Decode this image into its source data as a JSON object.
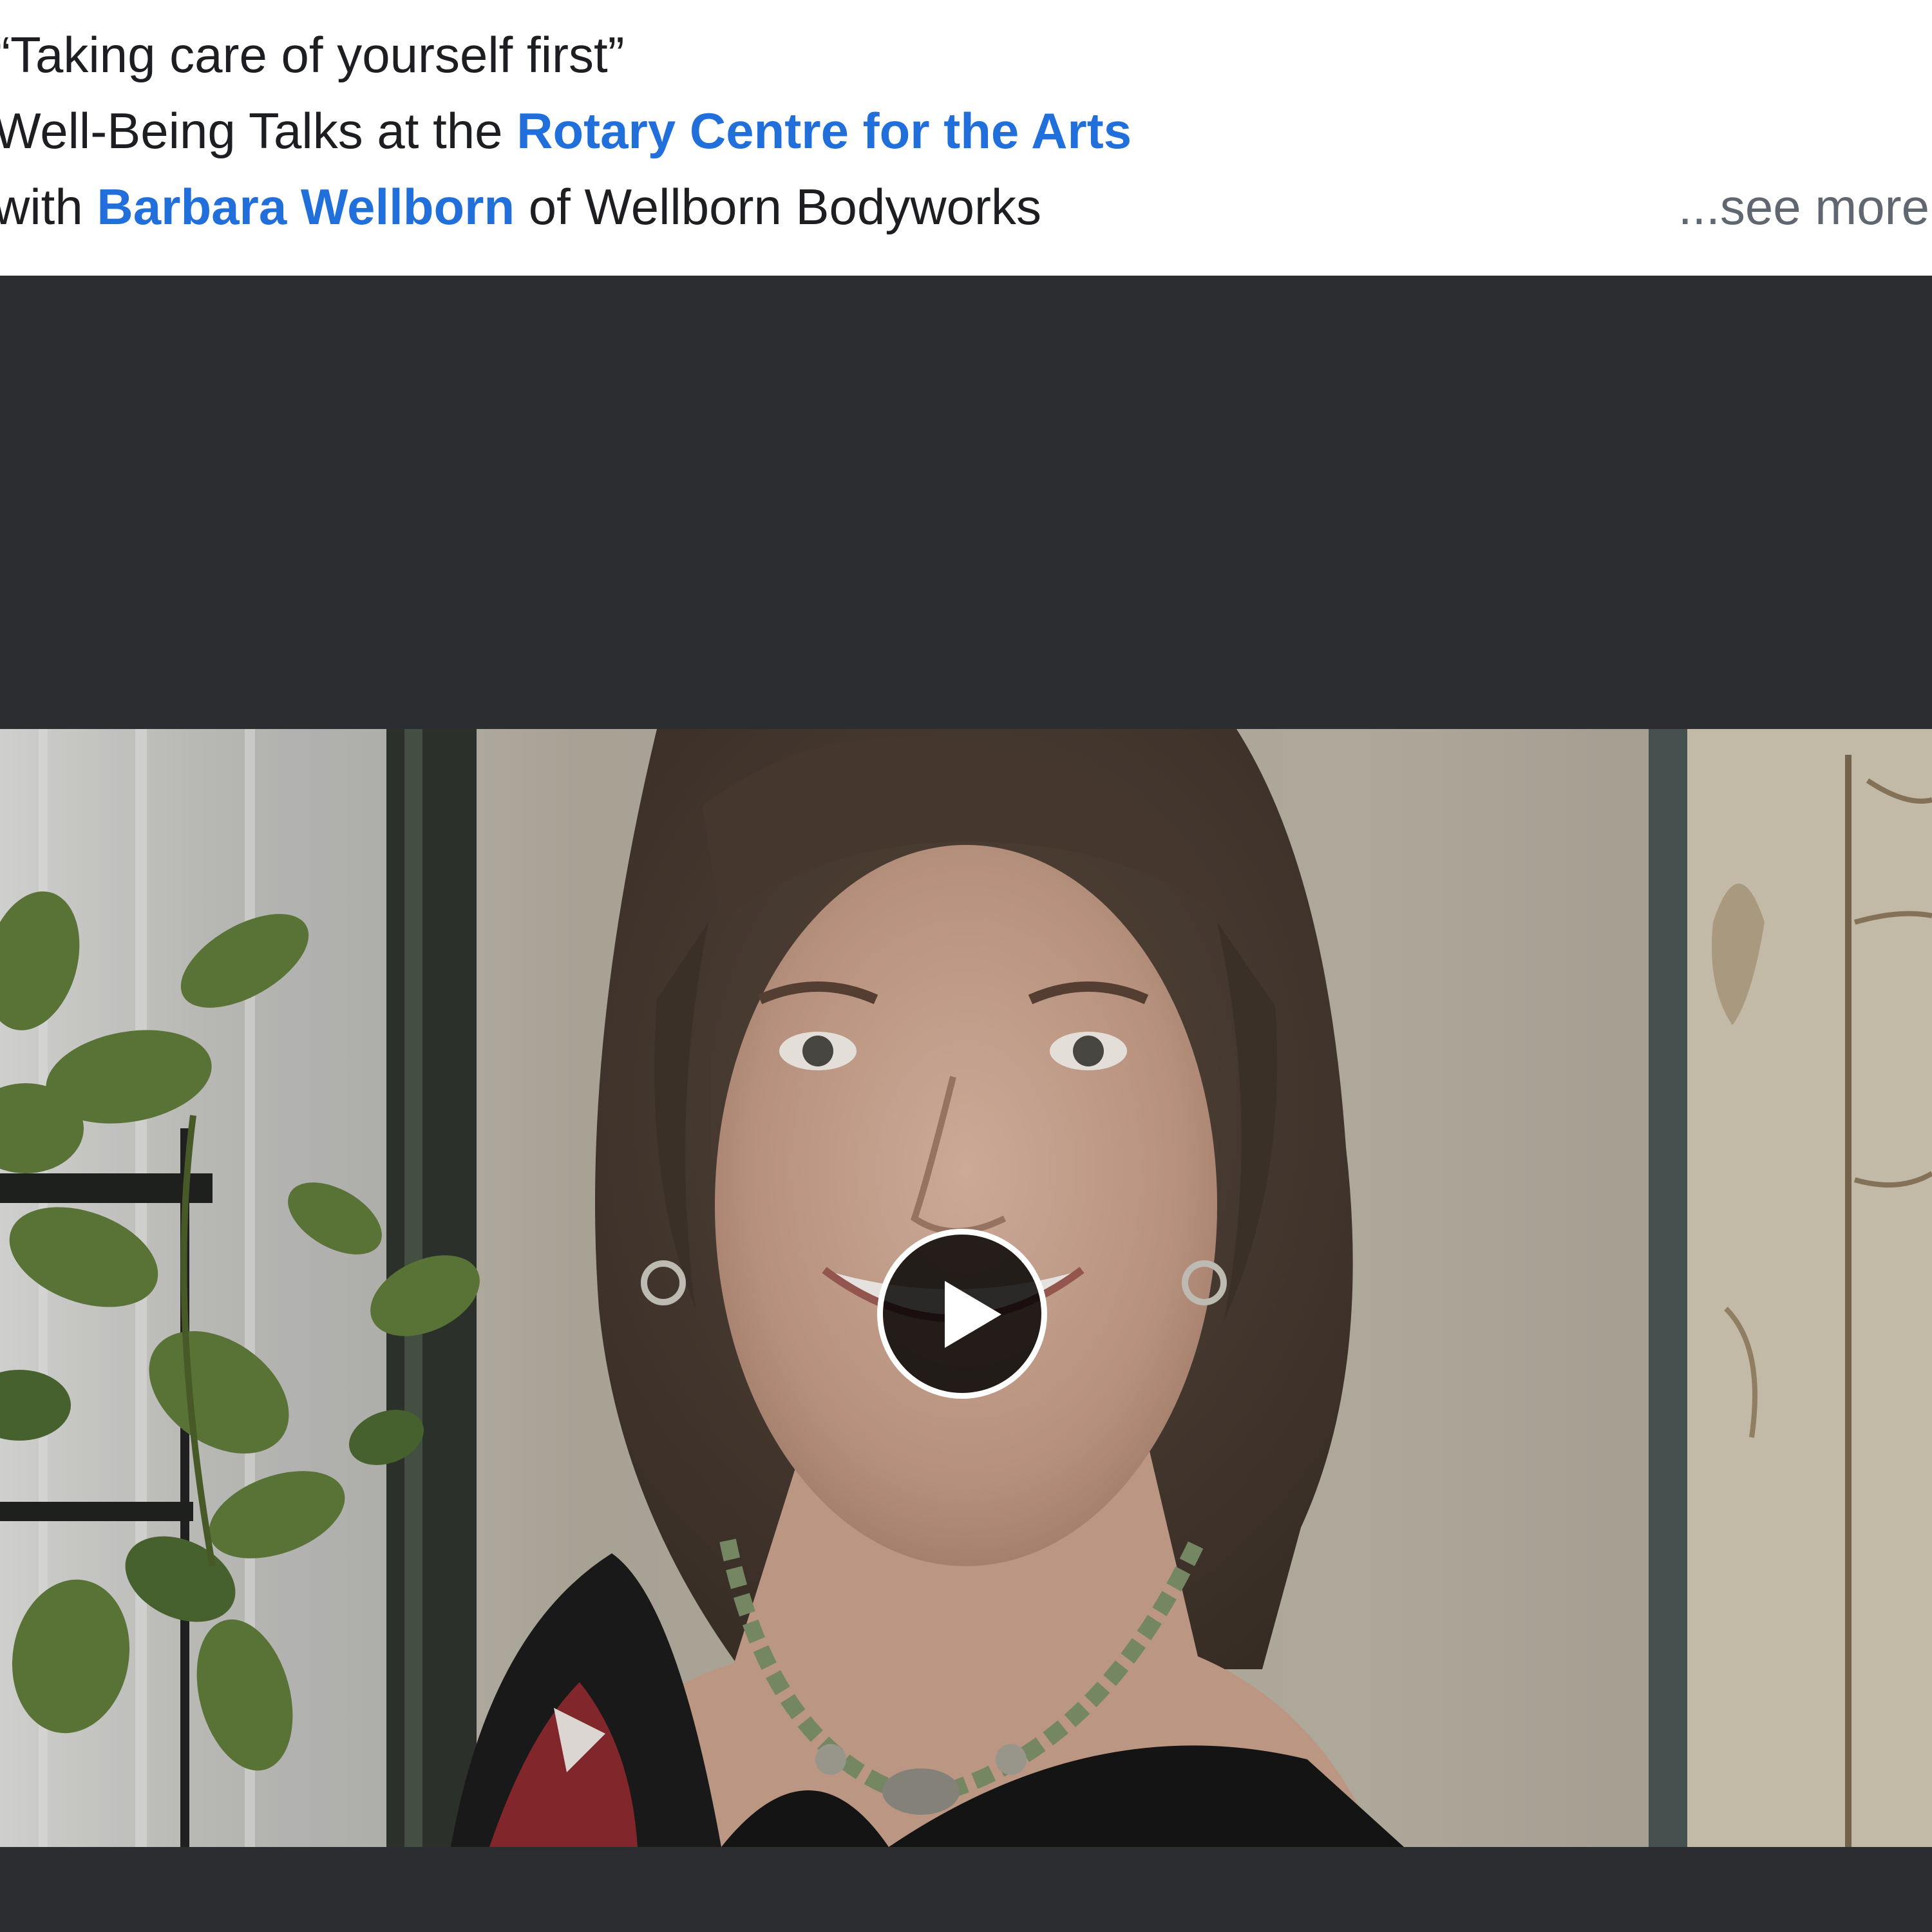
{
  "post": {
    "caption_line1": "“Taking care of yourself first”",
    "caption_line2_prefix": "Well-Being Talks at the ",
    "caption_line2_link": "Rotary Centre for the Arts",
    "caption_line3_prefix": "with ",
    "caption_line3_link": "Barbara Wellborn",
    "caption_line3_suffix": " of Wellborn Bodyworks",
    "see_more": "...see more"
  },
  "video": {
    "thumbnail": "woman-smiling-with-plant-thumbnail",
    "play_icon": "play-icon"
  },
  "colors": {
    "link": "#216fdb",
    "text": "#1c1e21",
    "muted": "#606770",
    "video_bg": "#2c2d30"
  }
}
